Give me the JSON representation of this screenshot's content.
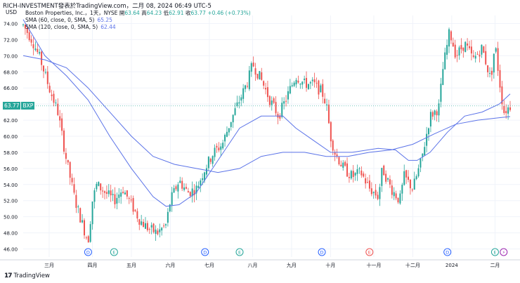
{
  "header": {
    "topline": "RICH-INVESTMENT發表於TradingView.com，二月 08, 2024 06:49 UTC-5",
    "currency": "USD",
    "symbol_line": "Boston Properties, Inc.，1天，NYSE",
    "ohlc": {
      "o_label": "開",
      "o": "63.64",
      "h_label": "高",
      "h": "64.23",
      "l_label": "低",
      "l": "62.91",
      "c_label": "收",
      "c": "63.77",
      "change": "+0.46 (+0.73%)"
    },
    "sma1_label": "SMA (60, close, 0, SMA, 5)",
    "sma1_value": "65.25",
    "sma2_label": "SMA (120, close, 0, SMA, 5)",
    "sma2_value": "62.44"
  },
  "price_tag": {
    "price": "63.77",
    "symbol": "BXP"
  },
  "brand": {
    "logo": "17",
    "name": "TradingView"
  },
  "colors": {
    "up": "#26a69a",
    "down": "#ef5350",
    "sma": "#5b73e8",
    "grid": "#f0f3fa",
    "axis_text": "#131722"
  },
  "chart_data": {
    "type": "candlestick",
    "y_axis": {
      "min": 45.0,
      "max": 75.0,
      "ticks": [
        46.0,
        48.0,
        50.0,
        52.0,
        54.0,
        56.0,
        58.0,
        60.0,
        62.0,
        64.0,
        66.0,
        68.0,
        70.0,
        72.0,
        74.0
      ]
    },
    "y_tick_labels": [
      "46.00",
      "48.00",
      "50.00",
      "52.00",
      "54.00",
      "56.00",
      "58.00",
      "60.00",
      "62.00",
      "64.00",
      "66.00",
      "68.00",
      "70.00",
      "72.00",
      "74.00"
    ],
    "x_labels": [
      {
        "label": "三月",
        "t": 0.06
      },
      {
        "label": "四月",
        "t": 0.16
      },
      {
        "label": "五月",
        "t": 0.25
      },
      {
        "label": "六月",
        "t": 0.34
      },
      {
        "label": "七月",
        "t": 0.43
      },
      {
        "label": "八月",
        "t": 0.53
      },
      {
        "label": "九月",
        "t": 0.62
      },
      {
        "label": "十月",
        "t": 0.71
      },
      {
        "label": "十一月",
        "t": 0.81
      },
      {
        "label": "十二月",
        "t": 0.9
      },
      {
        "label": "2024",
        "t": 0.99
      },
      {
        "label": "二月",
        "t": 1.09
      }
    ],
    "path_points": [
      [
        0.0,
        73.8
      ],
      [
        0.02,
        72.0
      ],
      [
        0.04,
        69.5
      ],
      [
        0.06,
        66.0
      ],
      [
        0.08,
        63.0
      ],
      [
        0.1,
        57.0
      ],
      [
        0.12,
        52.0
      ],
      [
        0.14,
        48.5
      ],
      [
        0.15,
        47.0
      ],
      [
        0.16,
        52.0
      ],
      [
        0.17,
        54.0
      ],
      [
        0.19,
        53.0
      ],
      [
        0.21,
        52.0
      ],
      [
        0.23,
        53.5
      ],
      [
        0.25,
        51.5
      ],
      [
        0.27,
        49.5
      ],
      [
        0.29,
        48.5
      ],
      [
        0.31,
        48.0
      ],
      [
        0.33,
        49.0
      ],
      [
        0.34,
        52.0
      ],
      [
        0.36,
        54.5
      ],
      [
        0.38,
        53.0
      ],
      [
        0.4,
        53.5
      ],
      [
        0.42,
        56.0
      ],
      [
        0.44,
        58.0
      ],
      [
        0.46,
        59.0
      ],
      [
        0.48,
        62.0
      ],
      [
        0.5,
        64.5
      ],
      [
        0.52,
        67.0
      ],
      [
        0.53,
        69.0
      ],
      [
        0.55,
        67.0
      ],
      [
        0.57,
        64.5
      ],
      [
        0.59,
        62.5
      ],
      [
        0.61,
        65.0
      ],
      [
        0.63,
        67.5
      ],
      [
        0.65,
        66.5
      ],
      [
        0.67,
        66.5
      ],
      [
        0.69,
        65.5
      ],
      [
        0.7,
        64.0
      ],
      [
        0.71,
        60.0
      ],
      [
        0.72,
        58.0
      ],
      [
        0.74,
        56.0
      ],
      [
        0.76,
        55.0
      ],
      [
        0.78,
        55.5
      ],
      [
        0.8,
        53.5
      ],
      [
        0.82,
        52.5
      ],
      [
        0.83,
        56.0
      ],
      [
        0.85,
        53.5
      ],
      [
        0.87,
        52.0
      ],
      [
        0.88,
        55.0
      ],
      [
        0.9,
        53.5
      ],
      [
        0.92,
        57.0
      ],
      [
        0.94,
        62.5
      ],
      [
        0.96,
        63.5
      ],
      [
        0.97,
        68.5
      ],
      [
        0.985,
        73.0
      ],
      [
        1.0,
        70.0
      ],
      [
        1.02,
        71.5
      ],
      [
        1.04,
        69.5
      ],
      [
        1.06,
        71.0
      ],
      [
        1.08,
        67.0
      ],
      [
        1.09,
        71.5
      ],
      [
        1.1,
        67.0
      ],
      [
        1.11,
        63.0
      ],
      [
        1.125,
        63.77
      ]
    ],
    "sma60": [
      [
        0.0,
        74.5
      ],
      [
        0.05,
        70.0
      ],
      [
        0.1,
        67.5
      ],
      [
        0.15,
        64.5
      ],
      [
        0.2,
        60.0
      ],
      [
        0.25,
        56.0
      ],
      [
        0.3,
        52.5
      ],
      [
        0.33,
        51.3
      ],
      [
        0.36,
        51.5
      ],
      [
        0.4,
        53.0
      ],
      [
        0.45,
        57.0
      ],
      [
        0.5,
        61.0
      ],
      [
        0.55,
        62.5
      ],
      [
        0.6,
        62.5
      ],
      [
        0.63,
        61.0
      ],
      [
        0.67,
        59.5
      ],
      [
        0.71,
        58.0
      ],
      [
        0.76,
        58.0
      ],
      [
        0.82,
        58.5
      ],
      [
        0.86,
        58.3
      ],
      [
        0.89,
        57.0
      ],
      [
        0.91,
        57.0
      ],
      [
        0.94,
        58.0
      ],
      [
        0.98,
        60.5
      ],
      [
        1.02,
        62.5
      ],
      [
        1.06,
        63.0
      ],
      [
        1.1,
        64.0
      ],
      [
        1.125,
        65.25
      ]
    ],
    "sma120": [
      [
        0.0,
        70.0
      ],
      [
        0.05,
        69.5
      ],
      [
        0.1,
        68.5
      ],
      [
        0.15,
        66.0
      ],
      [
        0.2,
        63.0
      ],
      [
        0.25,
        60.0
      ],
      [
        0.3,
        57.5
      ],
      [
        0.35,
        56.5
      ],
      [
        0.4,
        56.0
      ],
      [
        0.45,
        55.5
      ],
      [
        0.5,
        56.0
      ],
      [
        0.55,
        57.5
      ],
      [
        0.6,
        58.0
      ],
      [
        0.65,
        58.0
      ],
      [
        0.7,
        57.5
      ],
      [
        0.75,
        57.5
      ],
      [
        0.8,
        58.0
      ],
      [
        0.85,
        58.3
      ],
      [
        0.9,
        59.0
      ],
      [
        0.95,
        60.3
      ],
      [
        1.0,
        61.5
      ],
      [
        1.05,
        62.0
      ],
      [
        1.1,
        62.3
      ],
      [
        1.125,
        62.44
      ]
    ],
    "events": [
      {
        "type": "D",
        "t": 0.15,
        "color": "#2962ff"
      },
      {
        "type": "E",
        "t": 0.21,
        "color": "#26a69a"
      },
      {
        "type": "D",
        "t": 0.42,
        "color": "#2962ff"
      },
      {
        "type": "E",
        "t": 0.5,
        "color": "#26a69a"
      },
      {
        "type": "D",
        "t": 0.69,
        "color": "#2962ff"
      },
      {
        "type": "E",
        "t": 0.8,
        "color": "#ef5350"
      },
      {
        "type": "D",
        "t": 0.98,
        "color": "#2962ff"
      },
      {
        "type": "E",
        "t": 1.09,
        "color": "#26a69a"
      },
      {
        "type": "⚡",
        "t": 1.11,
        "color": "#9c27b0"
      }
    ]
  }
}
